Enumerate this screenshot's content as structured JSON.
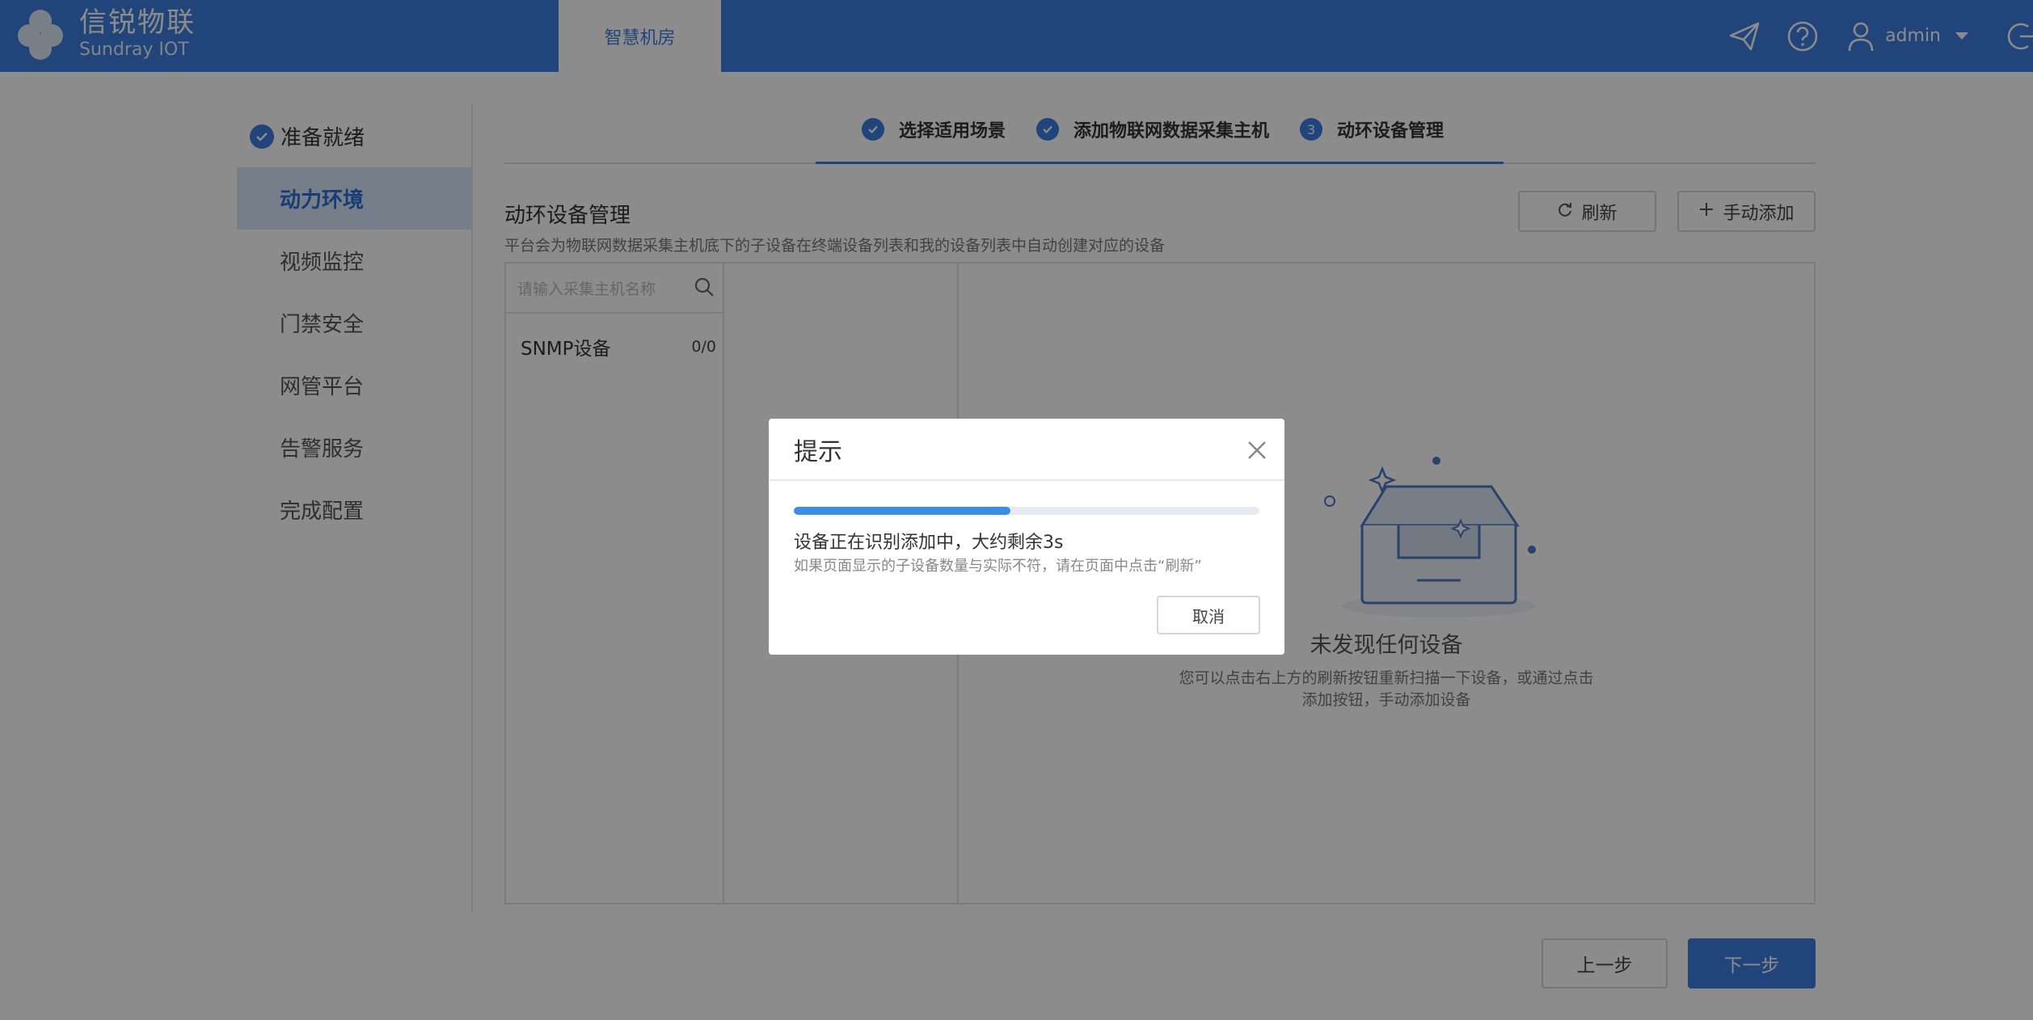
{
  "header": {
    "brand_cn": "信锐物联",
    "brand_en": "Sundray IOT",
    "active_tab": "智慧机房",
    "user": "admin",
    "brand_color": "#3d7fe0"
  },
  "sidebar": {
    "items": [
      {
        "label": "准备就绪",
        "status": "done"
      },
      {
        "label": "动力环境",
        "status": "active"
      },
      {
        "label": "视频监控"
      },
      {
        "label": "门禁安全"
      },
      {
        "label": "网管平台"
      },
      {
        "label": "告警服务"
      },
      {
        "label": "完成配置"
      }
    ]
  },
  "steps": [
    {
      "label": "选择适用场景",
      "status": "done"
    },
    {
      "label": "添加物联网数据采集主机",
      "status": "done"
    },
    {
      "number": "3",
      "label": "动环设备管理",
      "status": "current"
    }
  ],
  "section": {
    "title": "动环设备管理",
    "description": "平台会为物联网数据采集主机底下的子设备在终端设备列表和我的设备列表中自动创建对应的设备",
    "refresh_label": "刷新",
    "add_label": "手动添加"
  },
  "device_list": {
    "search_placeholder": "请输入采集主机名称",
    "items": [
      {
        "name": "SNMP设备",
        "count": "0/0"
      }
    ]
  },
  "empty_state": {
    "title": "未发现任何设备",
    "description": "您可以点击右上方的刷新按钮重新扫描一下设备，或通过点击添加按钮，手动添加设备"
  },
  "footer": {
    "prev_label": "上一步",
    "next_label": "下一步"
  },
  "modal": {
    "title": "提示",
    "progress": 0.465,
    "message": "设备正在识别添加中，大约剩余3s",
    "sub_message": "如果页面显示的子设备数量与实际不符，请在页面中点击“刷新”",
    "cancel_label": "取消"
  }
}
